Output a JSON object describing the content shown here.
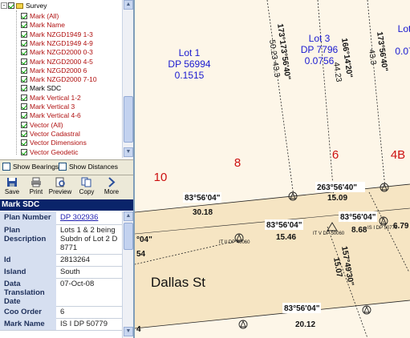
{
  "tree": {
    "root": "Survey",
    "items": [
      {
        "label": "Mark (All)",
        "color": "red"
      },
      {
        "label": "Mark Name",
        "color": "red"
      },
      {
        "label": "Mark NZGD1949 1-3",
        "color": "red"
      },
      {
        "label": "Mark NZGD1949 4-9",
        "color": "red"
      },
      {
        "label": "Mark NZGD2000 0-3",
        "color": "red"
      },
      {
        "label": "Mark NZGD2000 4-5",
        "color": "red"
      },
      {
        "label": "Mark NZGD2000 6",
        "color": "red"
      },
      {
        "label": "Mark NZGD2000 7-10",
        "color": "red"
      },
      {
        "label": "Mark SDC",
        "color": "black"
      },
      {
        "label": "Mark Vertical 1-2",
        "color": "red"
      },
      {
        "label": "Mark Vertical 3",
        "color": "red"
      },
      {
        "label": "Mark Vertical 4-6",
        "color": "red"
      },
      {
        "label": "Vector (All)",
        "color": "red"
      },
      {
        "label": "Vector Cadastral",
        "color": "red"
      },
      {
        "label": "Vector Dimensions",
        "color": "red"
      },
      {
        "label": "Vector Geodetic",
        "color": "red"
      }
    ]
  },
  "options": {
    "show_bearings": "Show Bearings",
    "show_distances": "Show Distances"
  },
  "toolbar": {
    "save": "Save",
    "print": "Print",
    "preview": "Preview",
    "copy": "Copy",
    "more": "More"
  },
  "panel_title": "Mark SDC",
  "properties": [
    {
      "key": "Plan Number",
      "value": "DP 302936",
      "link": true
    },
    {
      "key": "Plan Description",
      "value": "Lots 1 & 2 being Subdn of Lot 2 D 8771",
      "link": false
    },
    {
      "key": "Id",
      "value": "2813264",
      "link": false
    },
    {
      "key": "Island",
      "value": "South",
      "link": false
    },
    {
      "key": "Data Translation Date",
      "value": "07-Oct-08",
      "link": false
    },
    {
      "key": "Coo Order",
      "value": "6",
      "link": false
    },
    {
      "key": "Mark Name",
      "value": "IS I DP 50779",
      "link": false
    }
  ],
  "map": {
    "lot1": {
      "name": "Lot 1",
      "dp": "DP 56994",
      "area": "0.1515"
    },
    "lot3": {
      "name": "Lot 3",
      "dp": "DP 7796",
      "area": "0.0756"
    },
    "lot_edge": {
      "name": "Lot",
      "area": "0.07"
    },
    "parcel_numbers": [
      "10",
      "8",
      "6",
      "4B"
    ],
    "street": "Dallas St",
    "bearings": {
      "b1": "173°173°56'40\"",
      "b2": "50.23 43.3",
      "b3": "166°14'20\"",
      "b4": "44.23",
      "b5": "173°56'40\"",
      "b6": "43.3",
      "c1": "83°56'04\"",
      "c2": "30.18",
      "c3": "263°56'40\"",
      "c4": "15.09",
      "d1": "83°56'04\"",
      "d2": "15.46",
      "d3": "83°56'04\"",
      "d4": "8.68",
      "d5": "6.79",
      "e1": "157°49'30\"",
      "e2": "15.07",
      "f1": "83°56'04\"",
      "f2": "20.12",
      "left1": "°04\"",
      "left2": "54",
      "left3": "4"
    },
    "mark_labels": [
      "IT II DP 40060",
      "IT V DP 50060",
      "IS I DP 50779"
    ],
    "colors": {
      "road": "#f6e5c3",
      "land": "#fdf6e8",
      "red_text": "#cc1010",
      "blue_text": "#1a1ad0"
    }
  }
}
